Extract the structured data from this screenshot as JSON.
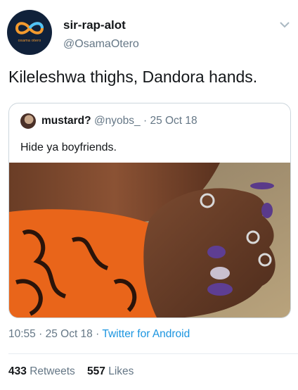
{
  "author": {
    "display_name": "sir-rap-alot",
    "handle": "@OsamaOtero",
    "avatar_text": "osama otero",
    "avatar_icon": "infinity-logo"
  },
  "tweet": {
    "text": "Kileleshwa thighs, Dandora hands."
  },
  "quoted_tweet": {
    "display_name": "mustard?",
    "handle": "@nyobs_",
    "separator": "·",
    "date": "25 Oct 18",
    "text": "Hide ya boyfriends."
  },
  "meta": {
    "time": "10:55",
    "separator": "·",
    "date": "25 Oct 18",
    "source": "Twitter for Android"
  },
  "stats": {
    "retweets_count": "433",
    "retweets_label": "Retweets",
    "likes_count": "557",
    "likes_label": "Likes"
  },
  "colors": {
    "secondary_text": "#657786",
    "link": "#1b95e0",
    "avatar_bg": "#10213a",
    "avatar_accent": "#f39a2e"
  }
}
